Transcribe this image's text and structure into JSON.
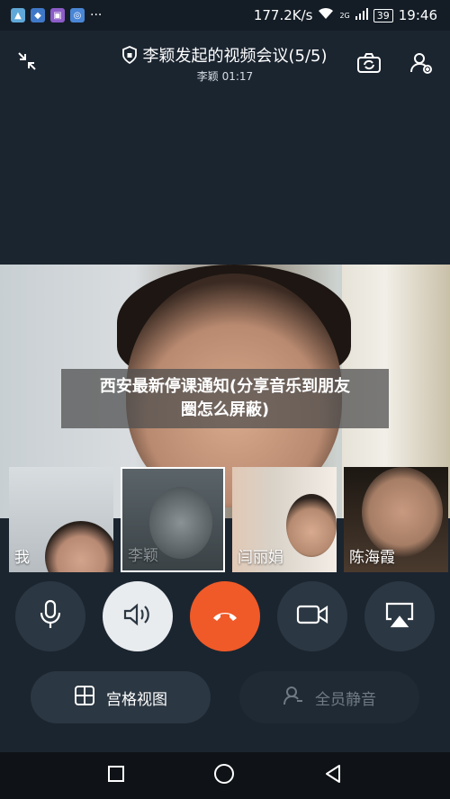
{
  "status_bar": {
    "network_speed": "177.2K/s",
    "signal_badge": "2G",
    "battery": "39",
    "time": "19:46",
    "more": "···",
    "app_icons": [
      "gallery-icon",
      "app-icon",
      "photo-icon",
      "browser-icon"
    ]
  },
  "header": {
    "title": "李颖发起的视频会议(5/5)",
    "subtitle": "李颖 01:17",
    "icons": [
      "minimize-icon",
      "shield-icon",
      "switch-camera-icon",
      "add-participant-icon"
    ]
  },
  "overlay": {
    "caption_line1": "西安最新停课通知(分享音乐到朋友",
    "caption_line2": "圈怎么屏蔽)"
  },
  "participants": [
    {
      "name": "我"
    },
    {
      "name": "李颖"
    },
    {
      "name": "闫丽娟"
    },
    {
      "name": "陈海霞"
    }
  ],
  "controls": {
    "icons": [
      "microphone-icon",
      "speaker-icon",
      "hang-up-icon",
      "video-camera-icon",
      "screen-share-icon"
    ]
  },
  "bottom_actions": {
    "grid_view": "宫格视图",
    "mute_all": "全员静音"
  },
  "navbar": {
    "icons": [
      "recents-icon",
      "home-icon",
      "back-icon"
    ]
  },
  "colors": {
    "background": "#1b2530",
    "hangup": "#f05a28",
    "control_dark": "#2b3742",
    "control_light": "#e9ecef"
  }
}
